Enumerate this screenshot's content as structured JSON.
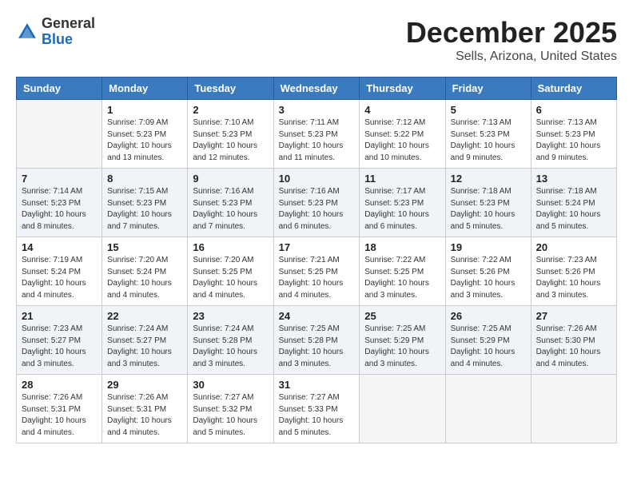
{
  "header": {
    "logo_general": "General",
    "logo_blue": "Blue",
    "month_title": "December 2025",
    "location": "Sells, Arizona, United States"
  },
  "weekdays": [
    "Sunday",
    "Monday",
    "Tuesday",
    "Wednesday",
    "Thursday",
    "Friday",
    "Saturday"
  ],
  "weeks": [
    [
      {
        "day": "",
        "info": ""
      },
      {
        "day": "1",
        "info": "Sunrise: 7:09 AM\nSunset: 5:23 PM\nDaylight: 10 hours\nand 13 minutes."
      },
      {
        "day": "2",
        "info": "Sunrise: 7:10 AM\nSunset: 5:23 PM\nDaylight: 10 hours\nand 12 minutes."
      },
      {
        "day": "3",
        "info": "Sunrise: 7:11 AM\nSunset: 5:23 PM\nDaylight: 10 hours\nand 11 minutes."
      },
      {
        "day": "4",
        "info": "Sunrise: 7:12 AM\nSunset: 5:22 PM\nDaylight: 10 hours\nand 10 minutes."
      },
      {
        "day": "5",
        "info": "Sunrise: 7:13 AM\nSunset: 5:23 PM\nDaylight: 10 hours\nand 9 minutes."
      },
      {
        "day": "6",
        "info": "Sunrise: 7:13 AM\nSunset: 5:23 PM\nDaylight: 10 hours\nand 9 minutes."
      }
    ],
    [
      {
        "day": "7",
        "info": "Sunrise: 7:14 AM\nSunset: 5:23 PM\nDaylight: 10 hours\nand 8 minutes."
      },
      {
        "day": "8",
        "info": "Sunrise: 7:15 AM\nSunset: 5:23 PM\nDaylight: 10 hours\nand 7 minutes."
      },
      {
        "day": "9",
        "info": "Sunrise: 7:16 AM\nSunset: 5:23 PM\nDaylight: 10 hours\nand 7 minutes."
      },
      {
        "day": "10",
        "info": "Sunrise: 7:16 AM\nSunset: 5:23 PM\nDaylight: 10 hours\nand 6 minutes."
      },
      {
        "day": "11",
        "info": "Sunrise: 7:17 AM\nSunset: 5:23 PM\nDaylight: 10 hours\nand 6 minutes."
      },
      {
        "day": "12",
        "info": "Sunrise: 7:18 AM\nSunset: 5:23 PM\nDaylight: 10 hours\nand 5 minutes."
      },
      {
        "day": "13",
        "info": "Sunrise: 7:18 AM\nSunset: 5:24 PM\nDaylight: 10 hours\nand 5 minutes."
      }
    ],
    [
      {
        "day": "14",
        "info": "Sunrise: 7:19 AM\nSunset: 5:24 PM\nDaylight: 10 hours\nand 4 minutes."
      },
      {
        "day": "15",
        "info": "Sunrise: 7:20 AM\nSunset: 5:24 PM\nDaylight: 10 hours\nand 4 minutes."
      },
      {
        "day": "16",
        "info": "Sunrise: 7:20 AM\nSunset: 5:25 PM\nDaylight: 10 hours\nand 4 minutes."
      },
      {
        "day": "17",
        "info": "Sunrise: 7:21 AM\nSunset: 5:25 PM\nDaylight: 10 hours\nand 4 minutes."
      },
      {
        "day": "18",
        "info": "Sunrise: 7:22 AM\nSunset: 5:25 PM\nDaylight: 10 hours\nand 3 minutes."
      },
      {
        "day": "19",
        "info": "Sunrise: 7:22 AM\nSunset: 5:26 PM\nDaylight: 10 hours\nand 3 minutes."
      },
      {
        "day": "20",
        "info": "Sunrise: 7:23 AM\nSunset: 5:26 PM\nDaylight: 10 hours\nand 3 minutes."
      }
    ],
    [
      {
        "day": "21",
        "info": "Sunrise: 7:23 AM\nSunset: 5:27 PM\nDaylight: 10 hours\nand 3 minutes."
      },
      {
        "day": "22",
        "info": "Sunrise: 7:24 AM\nSunset: 5:27 PM\nDaylight: 10 hours\nand 3 minutes."
      },
      {
        "day": "23",
        "info": "Sunrise: 7:24 AM\nSunset: 5:28 PM\nDaylight: 10 hours\nand 3 minutes."
      },
      {
        "day": "24",
        "info": "Sunrise: 7:25 AM\nSunset: 5:28 PM\nDaylight: 10 hours\nand 3 minutes."
      },
      {
        "day": "25",
        "info": "Sunrise: 7:25 AM\nSunset: 5:29 PM\nDaylight: 10 hours\nand 3 minutes."
      },
      {
        "day": "26",
        "info": "Sunrise: 7:25 AM\nSunset: 5:29 PM\nDaylight: 10 hours\nand 4 minutes."
      },
      {
        "day": "27",
        "info": "Sunrise: 7:26 AM\nSunset: 5:30 PM\nDaylight: 10 hours\nand 4 minutes."
      }
    ],
    [
      {
        "day": "28",
        "info": "Sunrise: 7:26 AM\nSunset: 5:31 PM\nDaylight: 10 hours\nand 4 minutes."
      },
      {
        "day": "29",
        "info": "Sunrise: 7:26 AM\nSunset: 5:31 PM\nDaylight: 10 hours\nand 4 minutes."
      },
      {
        "day": "30",
        "info": "Sunrise: 7:27 AM\nSunset: 5:32 PM\nDaylight: 10 hours\nand 5 minutes."
      },
      {
        "day": "31",
        "info": "Sunrise: 7:27 AM\nSunset: 5:33 PM\nDaylight: 10 hours\nand 5 minutes."
      },
      {
        "day": "",
        "info": ""
      },
      {
        "day": "",
        "info": ""
      },
      {
        "day": "",
        "info": ""
      }
    ]
  ]
}
